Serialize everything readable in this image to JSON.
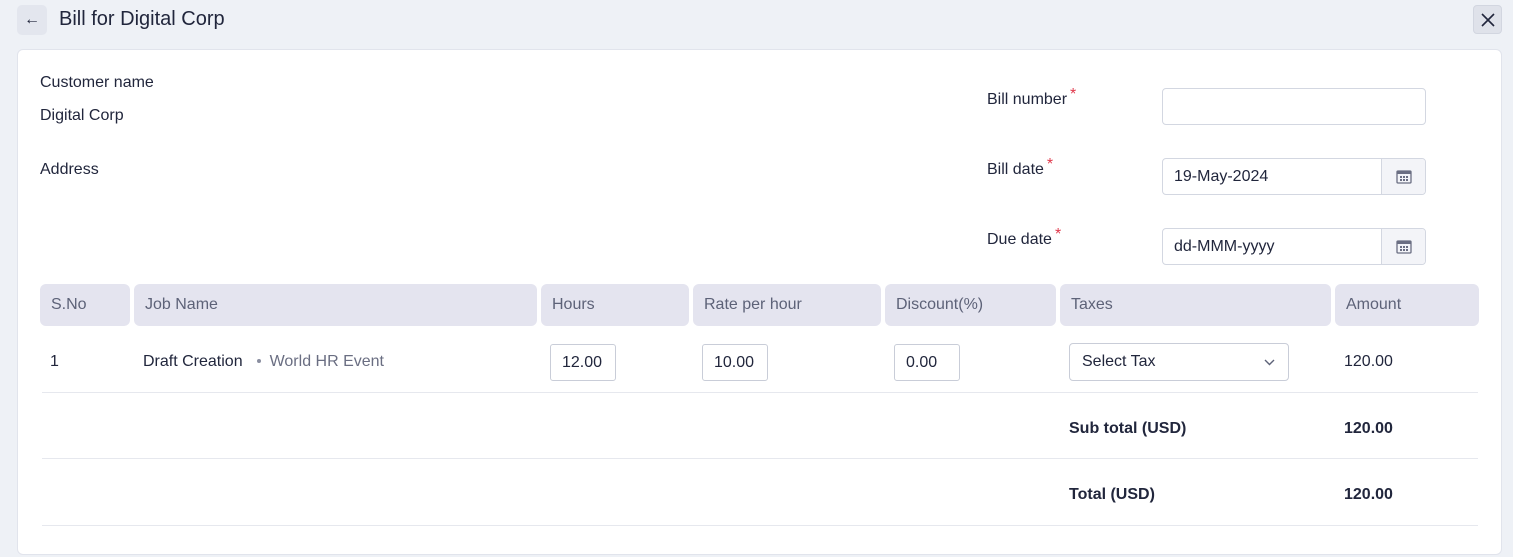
{
  "header": {
    "back_label": "←",
    "title": "Bill for Digital Corp"
  },
  "customer": {
    "name_label": "Customer name",
    "name_value": "Digital Corp",
    "address_label": "Address"
  },
  "bill": {
    "number_label": "Bill number",
    "number_value": "",
    "date_label": "Bill date",
    "date_value": "19-May-2024",
    "due_label": "Due date",
    "due_placeholder": "dd-MMM-yyyy",
    "required_mark": "*"
  },
  "table": {
    "headers": [
      "S.No",
      "Job Name",
      "Hours",
      "Rate per hour",
      "Discount(%)",
      "Taxes",
      "Amount"
    ],
    "rows": [
      {
        "sno": "1",
        "job": "Draft Creation",
        "project": "World HR Event",
        "hours": "12.00",
        "rate": "10.00",
        "discount": "0.00",
        "tax": "Select Tax",
        "amount": "120.00"
      }
    ]
  },
  "totals": {
    "subtotal_label": "Sub total (USD)",
    "subtotal_value": "120.00",
    "total_label": "Total (USD)",
    "total_value": "120.00"
  },
  "colors": {
    "accent_required": "#e0384b",
    "header_bg": "#e4e4ef",
    "page_bg": "#eef1f6"
  }
}
